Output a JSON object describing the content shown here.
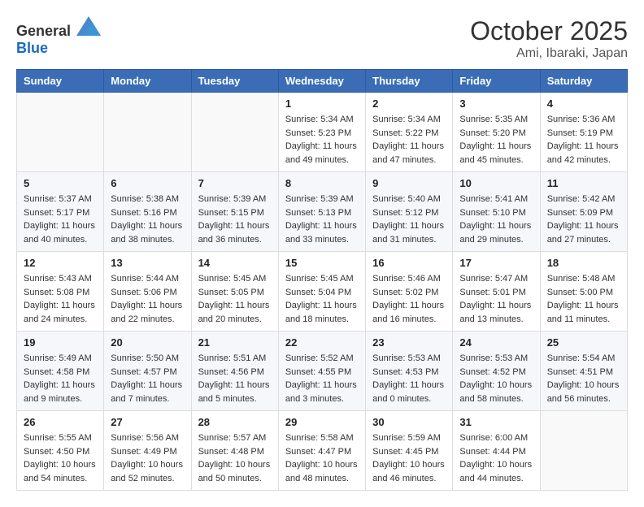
{
  "header": {
    "logo_general": "General",
    "logo_blue": "Blue",
    "month_title": "October 2025",
    "location": "Ami, Ibaraki, Japan"
  },
  "weekdays": [
    "Sunday",
    "Monday",
    "Tuesday",
    "Wednesday",
    "Thursday",
    "Friday",
    "Saturday"
  ],
  "weeks": [
    [
      {
        "day": "",
        "info": ""
      },
      {
        "day": "",
        "info": ""
      },
      {
        "day": "",
        "info": ""
      },
      {
        "day": "1",
        "info": "Sunrise: 5:34 AM\nSunset: 5:23 PM\nDaylight: 11 hours\nand 49 minutes."
      },
      {
        "day": "2",
        "info": "Sunrise: 5:34 AM\nSunset: 5:22 PM\nDaylight: 11 hours\nand 47 minutes."
      },
      {
        "day": "3",
        "info": "Sunrise: 5:35 AM\nSunset: 5:20 PM\nDaylight: 11 hours\nand 45 minutes."
      },
      {
        "day": "4",
        "info": "Sunrise: 5:36 AM\nSunset: 5:19 PM\nDaylight: 11 hours\nand 42 minutes."
      }
    ],
    [
      {
        "day": "5",
        "info": "Sunrise: 5:37 AM\nSunset: 5:17 PM\nDaylight: 11 hours\nand 40 minutes."
      },
      {
        "day": "6",
        "info": "Sunrise: 5:38 AM\nSunset: 5:16 PM\nDaylight: 11 hours\nand 38 minutes."
      },
      {
        "day": "7",
        "info": "Sunrise: 5:39 AM\nSunset: 5:15 PM\nDaylight: 11 hours\nand 36 minutes."
      },
      {
        "day": "8",
        "info": "Sunrise: 5:39 AM\nSunset: 5:13 PM\nDaylight: 11 hours\nand 33 minutes."
      },
      {
        "day": "9",
        "info": "Sunrise: 5:40 AM\nSunset: 5:12 PM\nDaylight: 11 hours\nand 31 minutes."
      },
      {
        "day": "10",
        "info": "Sunrise: 5:41 AM\nSunset: 5:10 PM\nDaylight: 11 hours\nand 29 minutes."
      },
      {
        "day": "11",
        "info": "Sunrise: 5:42 AM\nSunset: 5:09 PM\nDaylight: 11 hours\nand 27 minutes."
      }
    ],
    [
      {
        "day": "12",
        "info": "Sunrise: 5:43 AM\nSunset: 5:08 PM\nDaylight: 11 hours\nand 24 minutes."
      },
      {
        "day": "13",
        "info": "Sunrise: 5:44 AM\nSunset: 5:06 PM\nDaylight: 11 hours\nand 22 minutes."
      },
      {
        "day": "14",
        "info": "Sunrise: 5:45 AM\nSunset: 5:05 PM\nDaylight: 11 hours\nand 20 minutes."
      },
      {
        "day": "15",
        "info": "Sunrise: 5:45 AM\nSunset: 5:04 PM\nDaylight: 11 hours\nand 18 minutes."
      },
      {
        "day": "16",
        "info": "Sunrise: 5:46 AM\nSunset: 5:02 PM\nDaylight: 11 hours\nand 16 minutes."
      },
      {
        "day": "17",
        "info": "Sunrise: 5:47 AM\nSunset: 5:01 PM\nDaylight: 11 hours\nand 13 minutes."
      },
      {
        "day": "18",
        "info": "Sunrise: 5:48 AM\nSunset: 5:00 PM\nDaylight: 11 hours\nand 11 minutes."
      }
    ],
    [
      {
        "day": "19",
        "info": "Sunrise: 5:49 AM\nSunset: 4:58 PM\nDaylight: 11 hours\nand 9 minutes."
      },
      {
        "day": "20",
        "info": "Sunrise: 5:50 AM\nSunset: 4:57 PM\nDaylight: 11 hours\nand 7 minutes."
      },
      {
        "day": "21",
        "info": "Sunrise: 5:51 AM\nSunset: 4:56 PM\nDaylight: 11 hours\nand 5 minutes."
      },
      {
        "day": "22",
        "info": "Sunrise: 5:52 AM\nSunset: 4:55 PM\nDaylight: 11 hours\nand 3 minutes."
      },
      {
        "day": "23",
        "info": "Sunrise: 5:53 AM\nSunset: 4:53 PM\nDaylight: 11 hours\nand 0 minutes."
      },
      {
        "day": "24",
        "info": "Sunrise: 5:53 AM\nSunset: 4:52 PM\nDaylight: 10 hours\nand 58 minutes."
      },
      {
        "day": "25",
        "info": "Sunrise: 5:54 AM\nSunset: 4:51 PM\nDaylight: 10 hours\nand 56 minutes."
      }
    ],
    [
      {
        "day": "26",
        "info": "Sunrise: 5:55 AM\nSunset: 4:50 PM\nDaylight: 10 hours\nand 54 minutes."
      },
      {
        "day": "27",
        "info": "Sunrise: 5:56 AM\nSunset: 4:49 PM\nDaylight: 10 hours\nand 52 minutes."
      },
      {
        "day": "28",
        "info": "Sunrise: 5:57 AM\nSunset: 4:48 PM\nDaylight: 10 hours\nand 50 minutes."
      },
      {
        "day": "29",
        "info": "Sunrise: 5:58 AM\nSunset: 4:47 PM\nDaylight: 10 hours\nand 48 minutes."
      },
      {
        "day": "30",
        "info": "Sunrise: 5:59 AM\nSunset: 4:45 PM\nDaylight: 10 hours\nand 46 minutes."
      },
      {
        "day": "31",
        "info": "Sunrise: 6:00 AM\nSunset: 4:44 PM\nDaylight: 10 hours\nand 44 minutes."
      },
      {
        "day": "",
        "info": ""
      }
    ]
  ]
}
